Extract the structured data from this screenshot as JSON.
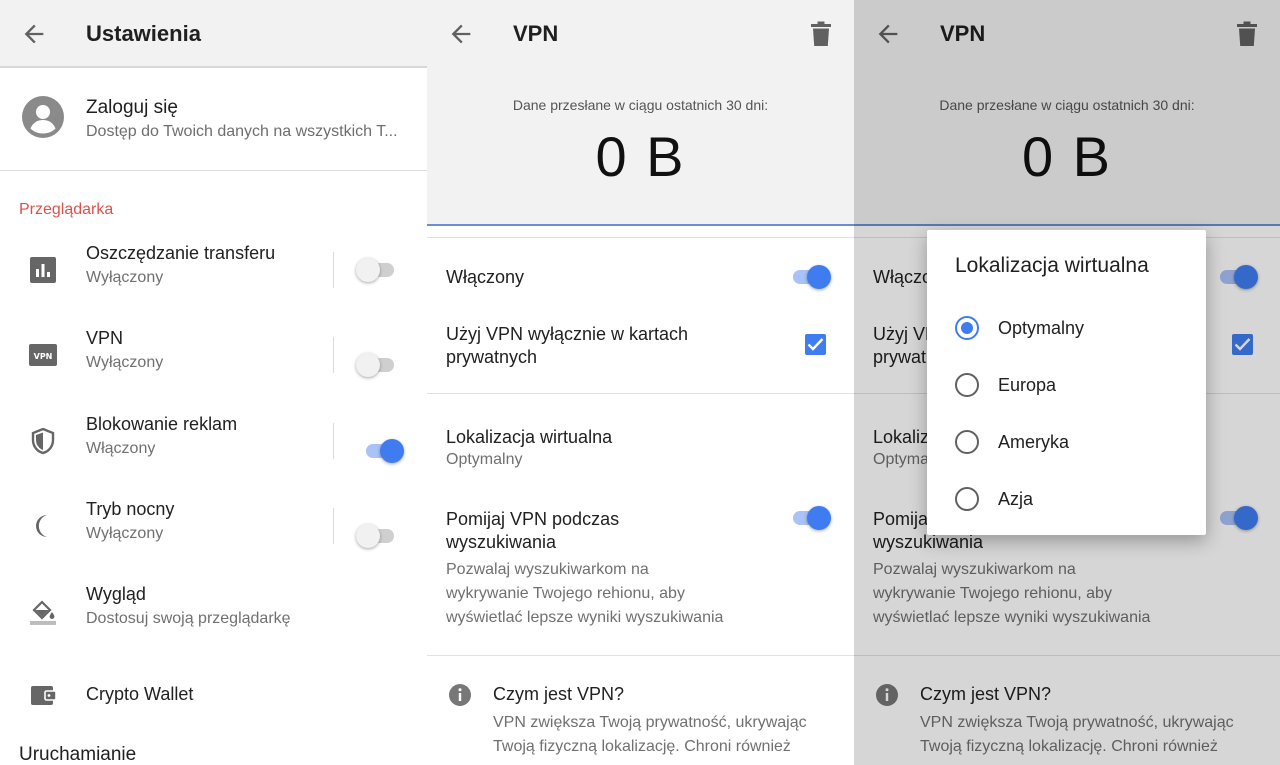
{
  "colors": {
    "accent": "#3f7cf0",
    "section_header": "#e0504a",
    "appbar_bg": "#f2f2f2"
  },
  "settings": {
    "title": "Ustawienia",
    "account": {
      "title": "Zaloguj się",
      "subtitle": "Dostęp do Twoich danych na wszystkich T..."
    },
    "section_browser": "Przeglądarka",
    "items": [
      {
        "icon": "bar-chart-icon",
        "title": "Oszczędzanie transferu",
        "subtitle": "Wyłączony",
        "enabled": false
      },
      {
        "icon": "vpn-icon",
        "title": "VPN",
        "subtitle": "Wyłączony",
        "enabled": false
      },
      {
        "icon": "shield-icon",
        "title": "Blokowanie reklam",
        "subtitle": "Włączony",
        "enabled": true
      },
      {
        "icon": "moon-icon",
        "title": "Tryb nocny",
        "subtitle": "Wyłączony",
        "enabled": false
      },
      {
        "icon": "paint-bucket-icon",
        "title": "Wygląd",
        "subtitle": "Dostosuj swoją przeglądarkę"
      },
      {
        "icon": "wallet-icon",
        "title": "Crypto Wallet"
      }
    ],
    "section_startup": "Uruchamianie"
  },
  "vpn": {
    "title": "VPN",
    "data_caption": "Dane przesłane w ciągu ostatnich 30 dni:",
    "data_value": "0 B",
    "enabled_label": "Włączony",
    "enabled": true,
    "private_only_label_1": "Użyj VPN wyłącznie w kartach",
    "private_only_label_2": "prywatnych",
    "private_only_checked": true,
    "location_label": "Lokalizacja wirtualna",
    "location_value": "Optymalny",
    "bypass_label_1": "Pomijaj VPN podczas",
    "bypass_label_2": "wyszukiwania",
    "bypass_enabled": true,
    "bypass_desc_1": "Pozwalaj wyszukiwarkom na",
    "bypass_desc_2": "wykrywanie Twojego rehionu, aby",
    "bypass_desc_3": "wyświetlać lepsze wyniki wyszukiwania",
    "info_title": "Czym jest VPN?",
    "info_desc_1": "VPN zwiększa Twoją prywatność, ukrywając",
    "info_desc_2": "Twoją fizyczną lokalizację. Chroni również"
  },
  "dialog": {
    "title": "Lokalizacja wirtualna",
    "selected": "Optymalny",
    "options": [
      "Optymalny",
      "Europa",
      "Ameryka",
      "Azja"
    ]
  }
}
